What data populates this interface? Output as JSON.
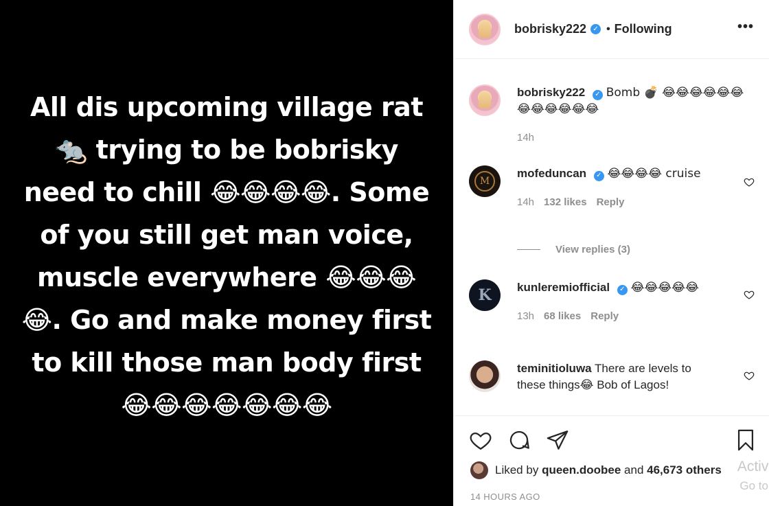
{
  "media": {
    "caption": "All dis upcoming village rat 🐀 trying to be bobrisky need to chill 😂😂😂😂. Some of you still get man voice, muscle everywhere 😂😂😂😂. Go and make money first to kill those man body first 😂😂😂😂😂😂😂"
  },
  "header": {
    "username": "bobrisky222",
    "verified_mark": "✓",
    "separator": "•",
    "follow_status": "Following",
    "more": "•••"
  },
  "caption_comment": {
    "username": "bobrisky222",
    "text": "Bomb 💣 😂😂😂😂😂😂😂😂😂😂😂😂",
    "time": "14h"
  },
  "comments": [
    {
      "username": "mofeduncan",
      "verified": true,
      "text": "😂😂😂😂 cruise",
      "time": "14h",
      "likes": "132 likes",
      "reply": "Reply",
      "avatar_letter": "M"
    },
    {
      "username": "kunleremiofficial",
      "verified": true,
      "text": "😂😂😂😂😂",
      "time": "13h",
      "likes": "68 likes",
      "reply": "Reply",
      "avatar_letter": "K"
    },
    {
      "username": "teminitioluwa",
      "verified": false,
      "text": "There are levels to these things😂 Bob of Lagos!"
    }
  ],
  "view_replies": "View replies (3)",
  "likes": {
    "prefix": "Liked by",
    "user": "queen.doobee",
    "middle": "and",
    "count": "46,673 others"
  },
  "timestamp": "14 HOURS AGO",
  "watermark": {
    "line1": "Activa",
    "line2": "Go to S"
  },
  "icons": {
    "more": "more-dots-icon",
    "like": "heart-icon",
    "comment": "comment-bubble-icon",
    "share": "paper-plane-icon",
    "save": "bookmark-icon",
    "comment_like": "heart-outline-icon"
  },
  "colors": {
    "verified": "#3897f0",
    "muted": "#8e8e8e",
    "text": "#262626",
    "media_bg": "#000000"
  }
}
